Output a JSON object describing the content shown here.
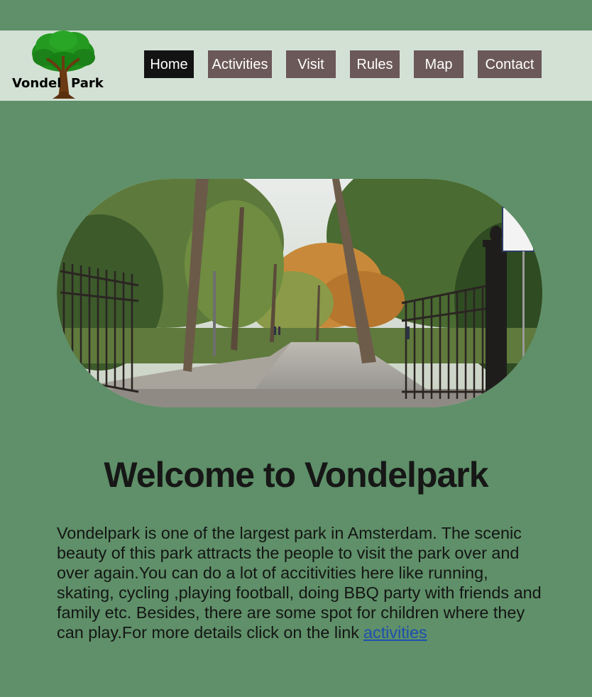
{
  "logo": {
    "word1": "Vondel",
    "word2": "Park",
    "icon": "tree-icon"
  },
  "nav": {
    "home": "Home",
    "activities": "Activities",
    "visit": "Visit",
    "rules": "Rules",
    "map": "Map",
    "contact": "Contact"
  },
  "hero": {
    "image": "park-entrance-gate-photo"
  },
  "main": {
    "title": "Welcome to Vondelpark",
    "intro": "Vondelpark is one of the largest park in Amsterdam. The scenic beauty of this park attracts the people to visit the park over and over again.You can do a lot of accitivities here  like running, skating, cycling ,playing football, doing BBQ party with friends and family etc. Besides, there are some spot for children where they can play.For more details click on the link",
    "link_text": "activities"
  },
  "colors": {
    "page_background": "#5f9069",
    "header_background": "#d3e1d5",
    "nav_button": "#6b5858",
    "nav_button_active": "#131313",
    "link": "#1f4fae"
  }
}
